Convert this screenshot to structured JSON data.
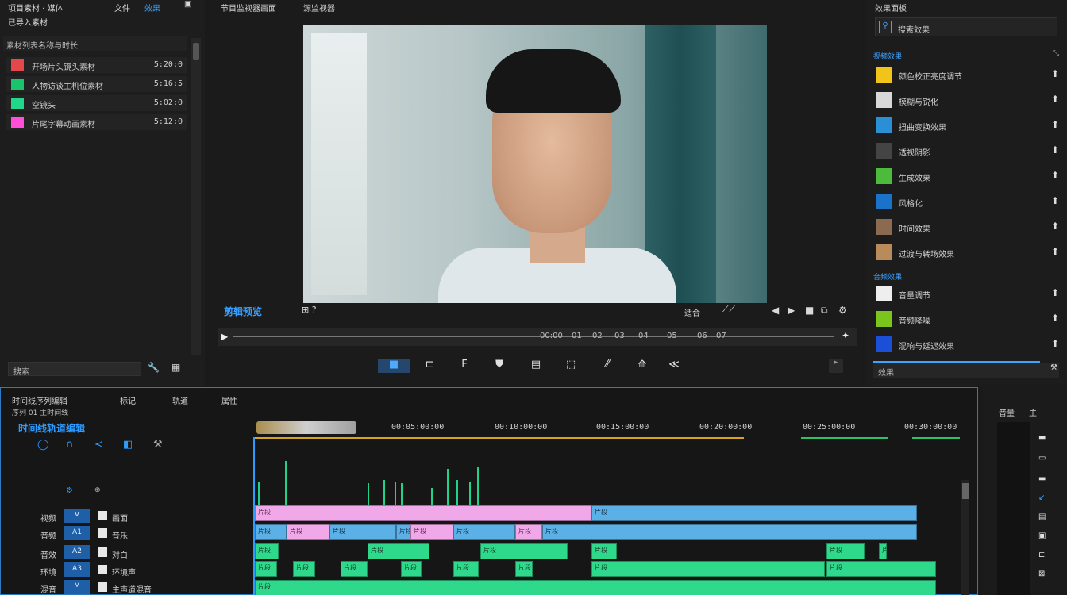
{
  "left_panel": {
    "top_a": "项目素材 · 媒体",
    "top_b": "文件",
    "top_c": "效果",
    "top_line2": "已导入素材",
    "list_header": "素材列表名称与时长",
    "items": [
      {
        "name": "开场片头镜头素材",
        "duration": "5:20:0",
        "color": "#e5474b"
      },
      {
        "name": "人物访谈主机位素材",
        "duration": "5:16:5",
        "color": "#19c46a"
      },
      {
        "name": "空镜头",
        "duration": "5:02:0",
        "color": "#22d68a"
      },
      {
        "name": "片尾字幕动画素材",
        "duration": "5:12:0",
        "color": "#ff4fd8"
      }
    ],
    "search_text": "搜索"
  },
  "viewer": {
    "title_a": "节目监视器画面",
    "title_b": "源监视器",
    "brand": "剪辑预览",
    "label_a": "适合",
    "scrub_labels": [
      "00:00",
      "01",
      "02",
      "03",
      "04",
      "05",
      "06",
      "07"
    ],
    "tools": [
      "■",
      "⊏",
      "F",
      "⛊",
      "▤",
      "⬚",
      "⁄⁄",
      "⟰",
      "≪"
    ]
  },
  "effects": {
    "title": "效果面板",
    "search_text": "搜索效果",
    "section_1": "视频效果",
    "section_2": "音频效果",
    "items": [
      {
        "name": "颜色校正亮度调节",
        "color": "#f2c318"
      },
      {
        "name": "模糊与锐化",
        "color": "#d8d8d8"
      },
      {
        "name": "扭曲变换效果",
        "color": "#2b8fd6"
      },
      {
        "name": "透视阴影",
        "color": "#444444"
      },
      {
        "name": "生成效果",
        "color": "#4cbb3b"
      },
      {
        "name": "风格化",
        "color": "#1a73c9"
      },
      {
        "name": "时间效果",
        "color": "#8b6a4f"
      },
      {
        "name": "过渡与转场效果",
        "color": "#b88c5a"
      },
      {
        "name": "音量调节",
        "color": "#eeeeee"
      },
      {
        "name": "音频降噪",
        "color": "#7ac61c"
      },
      {
        "name": "混响与延迟效果",
        "color": "#1b4fd8"
      }
    ],
    "bottom_text": "效果"
  },
  "timeline": {
    "tab_a": "时间线序列编辑",
    "tab_b": "标记",
    "tab_c": "轨道",
    "tab_d": "属性",
    "sub": "序列 01 主时间线",
    "title": "时间线轨道编辑",
    "times": [
      "00:05:00:00",
      "00:10:00:00",
      "00:15:00:00",
      "00:20:00:00",
      "00:25:00:00",
      "00:30:00:00"
    ],
    "tracks": [
      {
        "name": "视频",
        "btn": "V",
        "lab": "画面"
      },
      {
        "name": "音频",
        "btn": "A1",
        "lab": "音乐"
      },
      {
        "name": "音效",
        "btn": "A2",
        "lab": "对白"
      },
      {
        "name": "环境",
        "btn": "A3",
        "lab": "环境声"
      },
      {
        "name": "混音",
        "btn": "M",
        "lab": "主声道混音"
      }
    ],
    "clip_label": "片段"
  },
  "meters": {
    "hdr_a": "音量",
    "hdr_b": "主"
  }
}
